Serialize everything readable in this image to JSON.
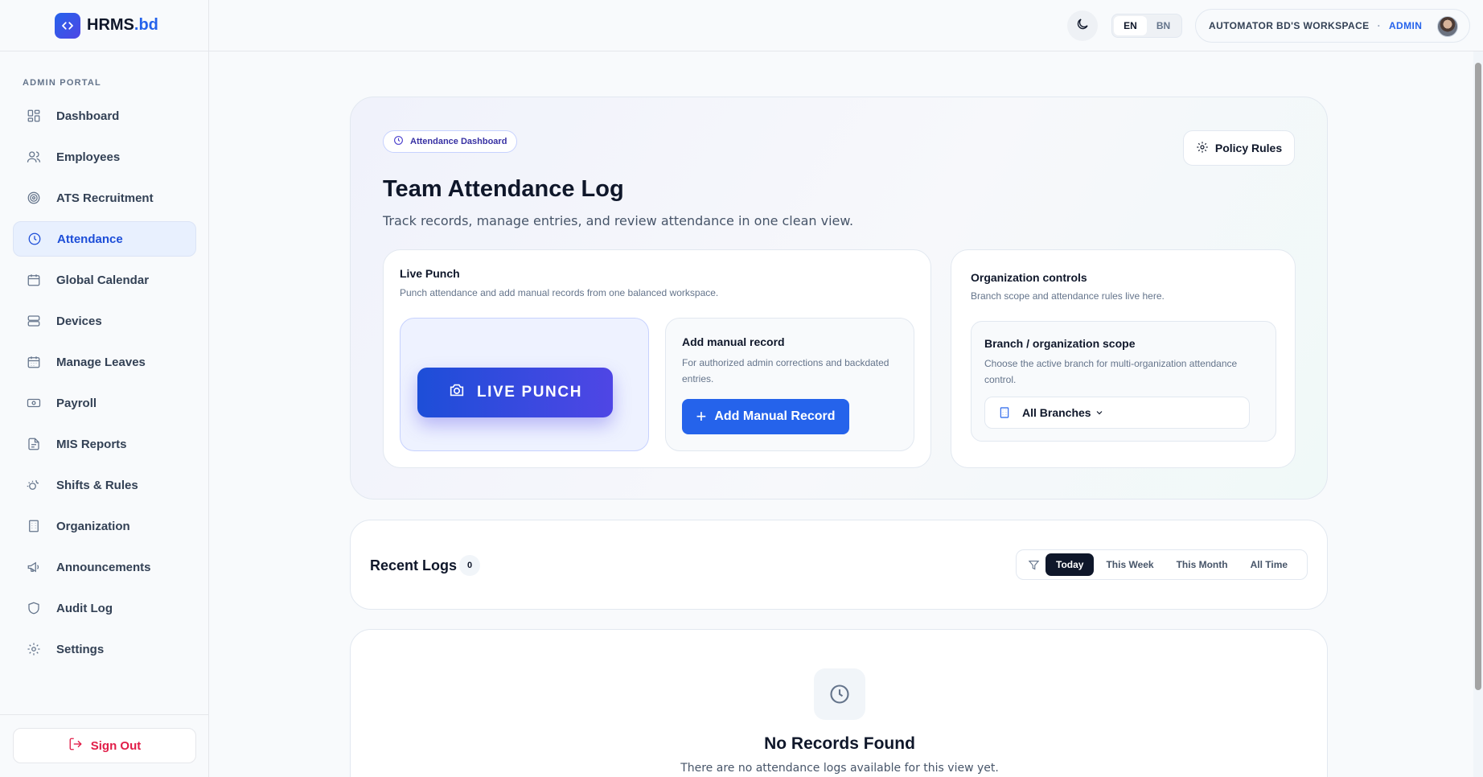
{
  "brand": {
    "name": "HRMS",
    "tld": ".bd"
  },
  "sidebar": {
    "section_label": "ADMIN PORTAL",
    "items": [
      {
        "label": "Dashboard",
        "icon": "dashboard-icon"
      },
      {
        "label": "Employees",
        "icon": "users-icon"
      },
      {
        "label": "ATS Recruitment",
        "icon": "target-icon"
      },
      {
        "label": "Attendance",
        "icon": "clock-icon",
        "active": true
      },
      {
        "label": "Global Calendar",
        "icon": "calendar-icon"
      },
      {
        "label": "Devices",
        "icon": "server-icon"
      },
      {
        "label": "Manage Leaves",
        "icon": "calendar-days-icon"
      },
      {
        "label": "Payroll",
        "icon": "banknote-icon"
      },
      {
        "label": "MIS Reports",
        "icon": "file-report-icon"
      },
      {
        "label": "Shifts & Rules",
        "icon": "sun-moon-icon"
      },
      {
        "label": "Organization",
        "icon": "building-icon"
      },
      {
        "label": "Announcements",
        "icon": "megaphone-icon"
      },
      {
        "label": "Audit Log",
        "icon": "shield-icon"
      },
      {
        "label": "Settings",
        "icon": "gear-icon"
      }
    ],
    "sign_out": "Sign Out"
  },
  "topbar": {
    "lang_en": "EN",
    "lang_bn": "BN",
    "workspace": "AUTOMATOR BD'S WORKSPACE",
    "separator": "·",
    "role": "ADMIN"
  },
  "hero": {
    "pill": "Attendance Dashboard",
    "policy_button": "Policy Rules",
    "title": "Team Attendance Log",
    "subtitle": "Track records, manage entries, and review attendance in one clean view.",
    "live": {
      "title": "Live Punch",
      "description": "Punch attendance and add manual records from one balanced workspace.",
      "punch_button": "LIVE PUNCH",
      "manual_title": "Add manual record",
      "manual_description": "For authorized admin corrections and backdated entries.",
      "manual_button": "Add Manual Record"
    },
    "org": {
      "title": "Organization controls",
      "description": "Branch scope and attendance rules live here.",
      "scope_title": "Branch / organization scope",
      "scope_description": "Choose the active branch for multi-organization attendance control.",
      "branch_value": "All Branches"
    }
  },
  "logs": {
    "title": "Recent Logs",
    "count": "0",
    "filters": [
      "Today",
      "This Week",
      "This Month",
      "All Time"
    ],
    "active_filter": "Today"
  },
  "empty": {
    "title": "No Records Found",
    "subtitle": "There are no attendance logs available for this view yet."
  },
  "colors": {
    "accent": "#2563eb",
    "indigo": "#4f46e5",
    "danger": "#e11d48",
    "dark": "#0f172a"
  }
}
